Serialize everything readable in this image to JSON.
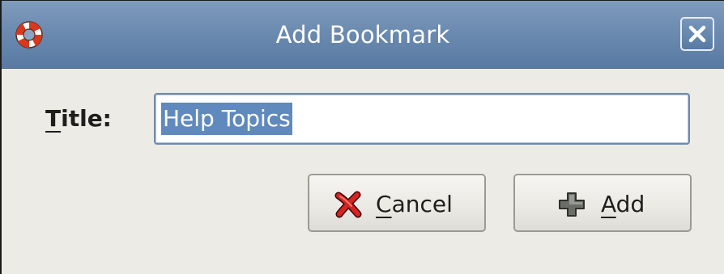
{
  "window": {
    "title": "Add Bookmark",
    "app_icon": "lifebuoy-icon",
    "close_icon": "close-icon"
  },
  "form": {
    "title_label_mnemonic": "T",
    "title_label_rest": "itle:",
    "title_value": "Help Topics",
    "title_value_selected": true
  },
  "buttons": {
    "cancel_mnemonic": "C",
    "cancel_rest": "ancel",
    "cancel_icon": "cancel-x-icon",
    "add_mnemonic": "A",
    "add_rest": "dd",
    "add_icon": "plus-icon"
  },
  "colors": {
    "titlebar": "#6c8bb0",
    "selection": "#6089bd",
    "background": "#edebe6"
  }
}
